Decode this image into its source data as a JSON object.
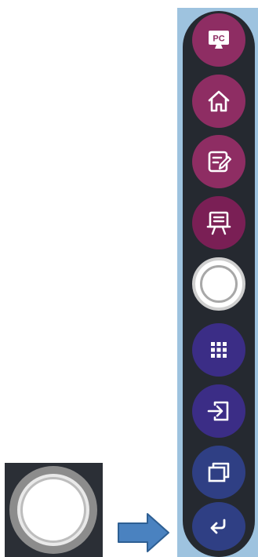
{
  "toolbar": {
    "buttons": [
      {
        "name": "pc",
        "label": "PC",
        "icon": "monitor-pc-icon",
        "color": "#8e2d63"
      },
      {
        "name": "home",
        "icon": "home-icon",
        "color": "#8e2d63"
      },
      {
        "name": "notes",
        "icon": "note-edit-icon",
        "color": "#8e2d63"
      },
      {
        "name": "presentation",
        "icon": "whiteboard-icon",
        "color": "#7a1f55"
      },
      {
        "name": "circle",
        "icon": "circle-icon",
        "color": "#ffffff"
      },
      {
        "name": "apps",
        "icon": "grid-icon",
        "color": "#3b2d86"
      },
      {
        "name": "input",
        "icon": "input-source-icon",
        "color": "#3b2d86"
      },
      {
        "name": "windows",
        "icon": "windows-icon",
        "color": "#2f3f84"
      },
      {
        "name": "back",
        "icon": "return-icon",
        "color": "#2f3f84"
      }
    ]
  },
  "preview": {
    "icon": "circle-icon"
  },
  "arrow": {
    "icon": "right-arrow-icon",
    "color": "#3f79b7"
  }
}
